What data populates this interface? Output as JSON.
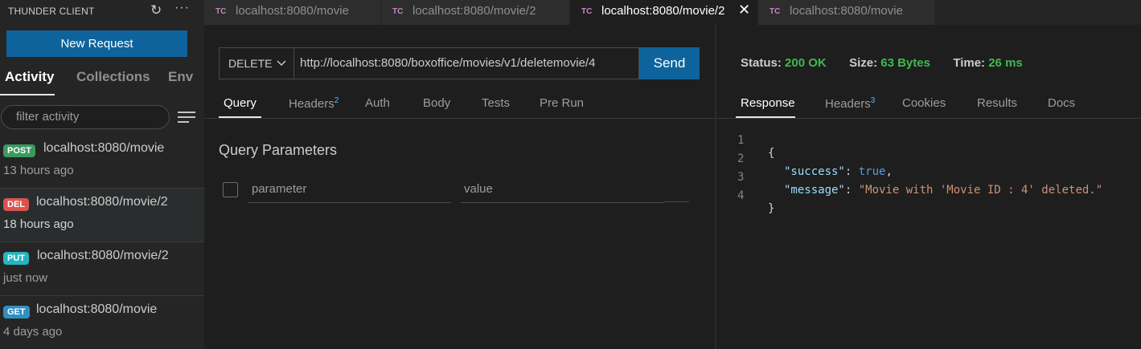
{
  "sidebar": {
    "title": "THUNDER CLIENT",
    "refresh_icon": "refresh-icon",
    "more_icon": "more-icon",
    "new_request": "New Request",
    "tabs": [
      {
        "label": "Activity",
        "active": true
      },
      {
        "label": "Collections",
        "active": false
      },
      {
        "label": "Env",
        "active": false
      }
    ],
    "filter_placeholder": "filter activity",
    "activities": [
      {
        "method": "POST",
        "method_color": "#3c9a5f",
        "url": "localhost:8080/movie",
        "time": "13 hours ago",
        "selected": false
      },
      {
        "method": "DEL",
        "method_color": "#d9534f",
        "url": "localhost:8080/movie/2",
        "time": "18 hours ago",
        "selected": true
      },
      {
        "method": "PUT",
        "method_color": "#25b5c0",
        "url": "localhost:8080/movie/2",
        "time": "just now",
        "selected": false
      },
      {
        "method": "GET",
        "method_color": "#2f8fbf",
        "url": "localhost:8080/movie",
        "time": "4 days ago",
        "selected": false
      }
    ]
  },
  "tabs": [
    {
      "icon": "TC",
      "label": "localhost:8080/movie",
      "active": false
    },
    {
      "icon": "TC",
      "label": "localhost:8080/movie/2",
      "active": false
    },
    {
      "icon": "TC",
      "label": "localhost:8080/movie/2",
      "active": true,
      "close": "✕"
    },
    {
      "icon": "TC",
      "label": "localhost:8080/movie",
      "active": false
    }
  ],
  "request": {
    "method": "DELETE",
    "url": "http://localhost:8080/boxoffice/movies/v1/deletemovie/4",
    "send": "Send",
    "tabs": [
      {
        "label": "Query",
        "count": ""
      },
      {
        "label": "Headers",
        "count": "2"
      },
      {
        "label": "Auth",
        "count": ""
      },
      {
        "label": "Body",
        "count": ""
      },
      {
        "label": "Tests",
        "count": ""
      },
      {
        "label": "Pre Run",
        "count": ""
      }
    ],
    "query_title": "Query Parameters",
    "param_placeholder": "parameter",
    "value_placeholder": "value"
  },
  "response": {
    "status_label": "Status:",
    "status_value": "200 OK",
    "size_label": "Size:",
    "size_value": "63 Bytes",
    "time_label": "Time:",
    "time_value": "26 ms",
    "tabs": [
      {
        "label": "Response",
        "count": ""
      },
      {
        "label": "Headers",
        "count": "3"
      },
      {
        "label": "Cookies",
        "count": ""
      },
      {
        "label": "Results",
        "count": ""
      },
      {
        "label": "Docs",
        "count": ""
      }
    ],
    "lines": [
      {
        "n": "1",
        "open": "{"
      },
      {
        "n": "2",
        "key": "\"success\"",
        "sep": ": ",
        "val": "true",
        "end": ","
      },
      {
        "n": "3",
        "key": "\"message\"",
        "sep": ": ",
        "val": "\"Movie with 'Movie ID : 4' deleted.\"",
        "end": ""
      },
      {
        "n": "4",
        "open": "}"
      }
    ]
  },
  "colors": {
    "accent": "#0e639c",
    "status_ok": "#3fb950",
    "tc_icon": "#c586c0"
  }
}
